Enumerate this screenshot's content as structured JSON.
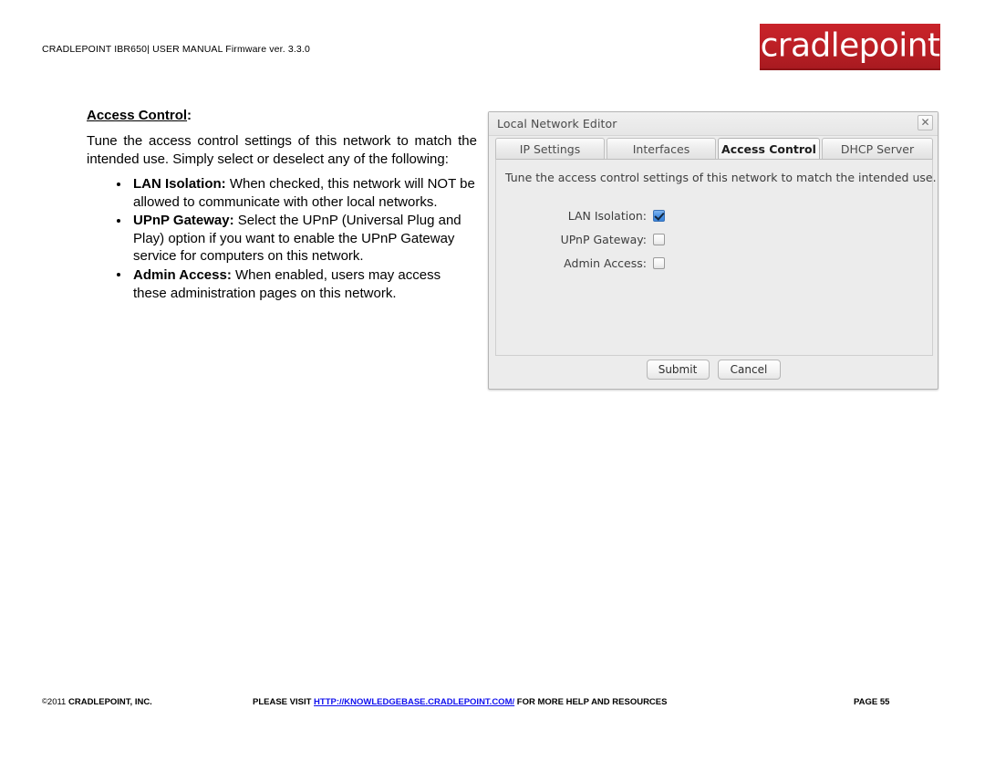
{
  "header": {
    "manual_line": "CRADLEPOINT IBR650| USER MANUAL Firmware ver. 3.3.0",
    "logo_text": "cradlepoint",
    "logo_color": "#c32026"
  },
  "document": {
    "section_title": "Access Control",
    "section_title_colon": ":",
    "intro_paragraph": "Tune the access control settings of this network to match the intended use. Simply select or deselect any of the following:",
    "bullets": [
      {
        "term": "LAN Isolation:",
        "text": " When checked, this network will NOT be allowed to communicate with other local networks."
      },
      {
        "term": "UPnP Gateway:",
        "text": " Select the UPnP (Universal Plug and Play) option if you want to enable the UPnP Gateway service for computers on this network."
      },
      {
        "term": "Admin Access:",
        "text": " When enabled, users may access these administration pages on this network."
      }
    ]
  },
  "dialog": {
    "title": "Local Network Editor",
    "close_icon": "close-icon",
    "close_glyph": "✕",
    "tabs": [
      {
        "label": "IP Settings",
        "active": false
      },
      {
        "label": "Interfaces",
        "active": false
      },
      {
        "label": "Access Control",
        "active": true
      },
      {
        "label": "DHCP Server",
        "active": false
      }
    ],
    "panel_description": "Tune the access control settings of this network to match the intended use.",
    "fields": [
      {
        "label": "LAN Isolation:",
        "checked": true
      },
      {
        "label": "UPnP Gateway:",
        "checked": false
      },
      {
        "label": "Admin Access:",
        "checked": false
      }
    ],
    "buttons": {
      "submit": "Submit",
      "cancel": "Cancel"
    }
  },
  "footer": {
    "copyright_symbol": "©",
    "copyright_year": "2011",
    "company": "CRADLEPOINT, INC.",
    "visit_prefix": "PLEASE VISIT ",
    "link_text": "HTTP://KNOWLEDGEBASE.CRADLEPOINT.COM/",
    "visit_suffix": " FOR MORE HELP AND RESOURCES",
    "page_label": "PAGE 55",
    "link_color": "#1010ee"
  }
}
